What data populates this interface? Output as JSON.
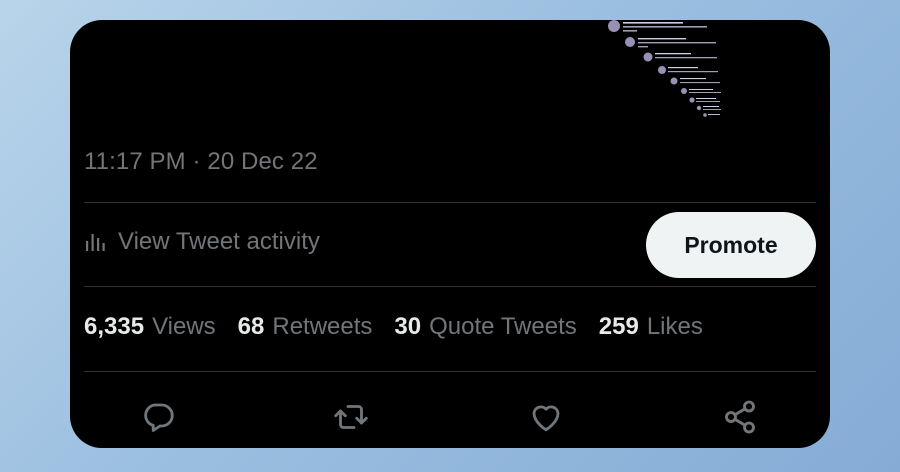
{
  "tweet": {
    "timestamp": "11:17 PM · 20 Dec 22"
  },
  "activity": {
    "label": "View Tweet activity",
    "icon": "bar-chart-icon"
  },
  "promote": {
    "label": "Promote"
  },
  "stats": [
    {
      "number": "6,335",
      "label": "Views"
    },
    {
      "number": "68",
      "label": "Retweets"
    },
    {
      "number": "30",
      "label": "Quote Tweets"
    },
    {
      "number": "259",
      "label": "Likes"
    }
  ],
  "actions": [
    {
      "icon": "reply-icon"
    },
    {
      "icon": "retweet-icon"
    },
    {
      "icon": "like-icon"
    },
    {
      "icon": "share-icon"
    }
  ],
  "colors": {
    "card_background": "#000000",
    "muted_text": "#71767b",
    "primary_text": "#e7e9ea",
    "divider": "#2f3336",
    "button_background": "#eff3f4",
    "button_text": "#0f1419"
  }
}
